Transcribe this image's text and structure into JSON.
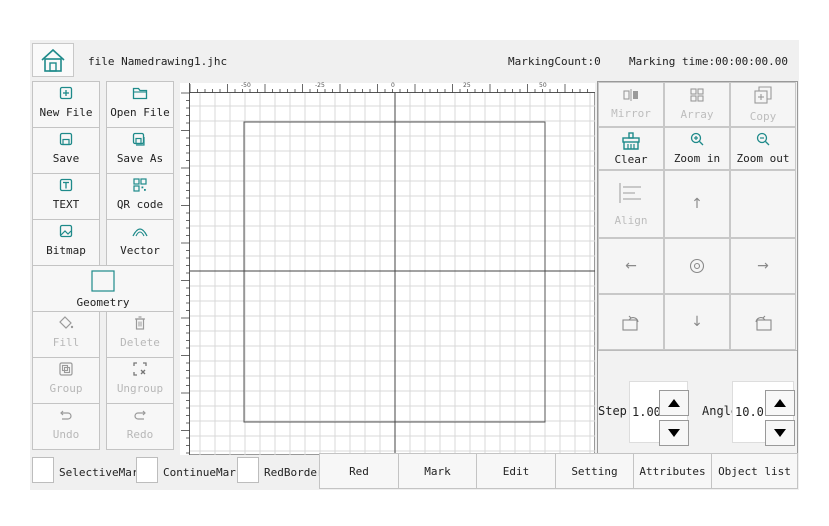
{
  "topbar": {
    "file_label": "file Namedrawing1.jhc",
    "marking_count": "MarkingCount:0",
    "marking_time": "Marking time:00:00:00.00"
  },
  "toolbox": {
    "new_file": "New File",
    "open_file": "Open File",
    "save": "Save",
    "save_as": "Save As",
    "text": "TEXT",
    "qr_code": "QR code",
    "bitmap": "Bitmap",
    "vector": "Vector",
    "geometry": "Geometry",
    "fill": "Fill",
    "delete": "Delete",
    "group": "Group",
    "ungroup": "Ungroup",
    "undo": "Undo",
    "redo": "Redo"
  },
  "ruler": {
    "labels": [
      "-50",
      "-25",
      "0",
      "25",
      "50"
    ]
  },
  "right_panel": {
    "mirror": "Mirror",
    "array": "Array",
    "copy": "Copy",
    "clear": "Clear",
    "zoom_in": "Zoom in",
    "zoom_out": "Zoom out",
    "align": "Align",
    "step_label": "Step",
    "step_value": "1.00",
    "angle_label": "Angle",
    "angle_value": "10.0"
  },
  "bottombar": {
    "selective_mark": "SelectiveMark",
    "continue_mark": "ContinueMark",
    "red_border": "RedBorder",
    "red": "Red",
    "mark": "Mark",
    "edit": "Edit",
    "setting": "Setting",
    "attributes": "Attributes",
    "object_list": "Object list"
  },
  "colors": {
    "accent": "#1e8a8a",
    "background": "#f0f0f0",
    "disabled_text": "#b8b8b8"
  }
}
